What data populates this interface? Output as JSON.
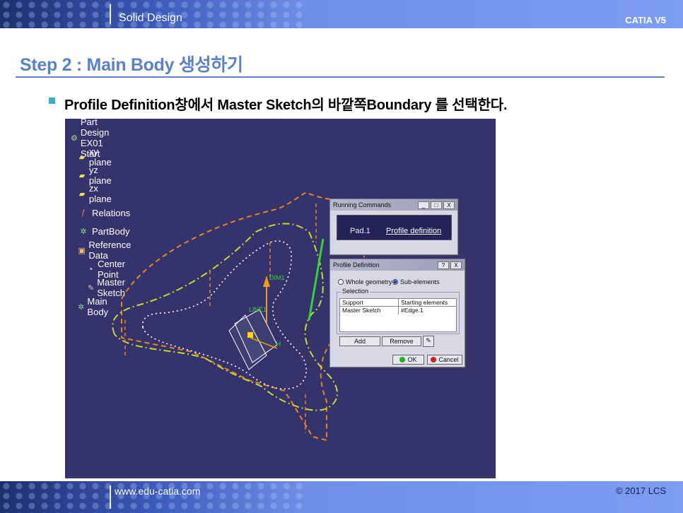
{
  "header": {
    "title": "Solid Design",
    "brand": "CATIA V5"
  },
  "slide": {
    "step_title": "Step 2 : Main Body 생성하기",
    "bullet_text": "Profile Definition창에서 Master Sketch의 바깥쪽Boundary 를 선택한다."
  },
  "tree": {
    "items": [
      {
        "label": "Part Design EX01 Start",
        "icon": "part-icon"
      },
      {
        "label": "xy plane",
        "icon": "plane-icon"
      },
      {
        "label": "yz plane",
        "icon": "plane-icon"
      },
      {
        "label": "zx plane",
        "icon": "plane-icon"
      },
      {
        "label": "Relations",
        "icon": "relations-icon"
      },
      {
        "label": "PartBody",
        "icon": "gear-icon"
      },
      {
        "label": "Reference Data",
        "icon": "folder-icon"
      },
      {
        "label": "Center Point",
        "icon": "point-icon"
      },
      {
        "label": "Master Sketch",
        "icon": "sketch-icon"
      },
      {
        "label": "Main Body",
        "icon": "gear-icon"
      }
    ]
  },
  "geometry_labels": {
    "dim1": "DIM1",
    "line1": "LINE1",
    "h": "H"
  },
  "running_commands": {
    "title": "Running Commands",
    "pad": "Pad.1",
    "link": "Profile definition",
    "window_buttons": [
      "_",
      "□",
      "X"
    ]
  },
  "profile_definition": {
    "title": "Profile Definition",
    "window_buttons": [
      "?",
      "X"
    ],
    "radio_whole": "Whole geometry",
    "radio_sub": "Sub-elements",
    "selected_radio": "Sub-elements",
    "selection_label": "Selection",
    "columns": [
      "Support",
      "Starting elements"
    ],
    "rows": [
      [
        "Master Sketch",
        "#Edge.1"
      ]
    ],
    "add": "Add",
    "remove": "Remove",
    "ok": "OK",
    "cancel": "Cancel"
  },
  "footer": {
    "url": "www.edu-catia.com",
    "copyright": "© 2017 LCS"
  },
  "colors": {
    "band": "#6f8fe8",
    "title_blue": "#5b82c8",
    "bullet": "#2fb3c8",
    "viewport_bg": "#34336b",
    "orange_dash": "#e8861e",
    "yellow_green": "#c8d832",
    "green_line": "#38d038"
  }
}
